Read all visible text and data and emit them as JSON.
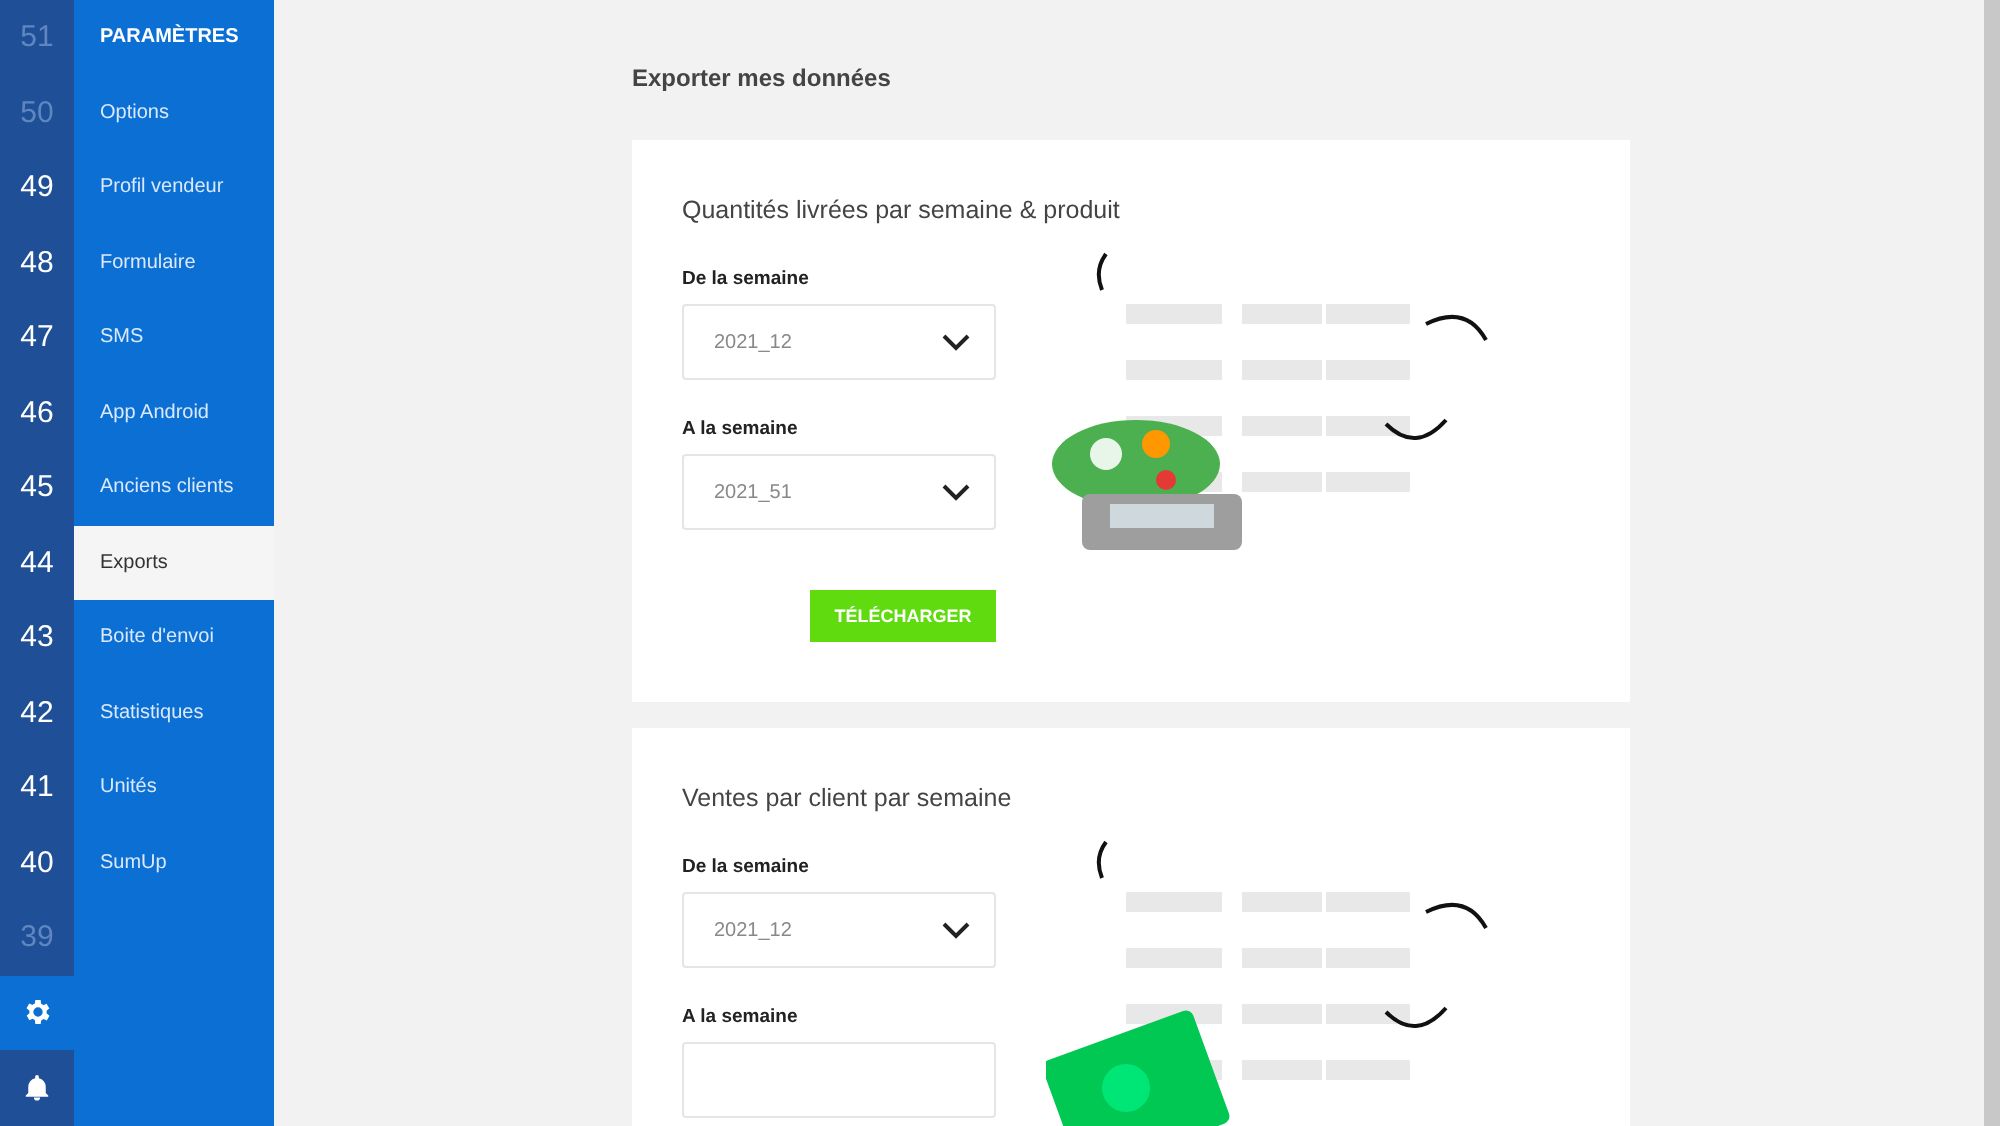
{
  "line_numbers": [
    {
      "label": "51",
      "dimmed": true
    },
    {
      "label": "50",
      "dimmed": true
    },
    {
      "label": "49",
      "dimmed": false
    },
    {
      "label": "48",
      "dimmed": false
    },
    {
      "label": "47",
      "dimmed": false
    },
    {
      "label": "46",
      "dimmed": false
    },
    {
      "label": "45",
      "dimmed": false
    },
    {
      "label": "44",
      "dimmed": false
    },
    {
      "label": "43",
      "dimmed": false
    },
    {
      "label": "42",
      "dimmed": false
    },
    {
      "label": "41",
      "dimmed": false
    },
    {
      "label": "40",
      "dimmed": false
    },
    {
      "label": "39",
      "dimmed": true
    }
  ],
  "sidebar": {
    "header": "PARAMÈTRES",
    "items": [
      {
        "label": "Options",
        "selected": false
      },
      {
        "label": "Profil vendeur",
        "selected": false
      },
      {
        "label": "Formulaire",
        "selected": false
      },
      {
        "label": "SMS",
        "selected": false
      },
      {
        "label": "App Android",
        "selected": false
      },
      {
        "label": "Anciens clients",
        "selected": false
      },
      {
        "label": "Exports",
        "selected": true
      },
      {
        "label": "Boite d'envoi",
        "selected": false
      },
      {
        "label": "Statistiques",
        "selected": false
      },
      {
        "label": "Unités",
        "selected": false
      },
      {
        "label": "SumUp",
        "selected": false
      }
    ]
  },
  "page_title": "Exporter mes données",
  "cards": [
    {
      "title": "Quantités livrées par semaine & produit",
      "kind": "produce",
      "from_label": "De la semaine",
      "from_value": "2021_12",
      "to_label": "A la semaine",
      "to_value": "2021_51",
      "button": "TÉLÉCHARGER"
    },
    {
      "title": "Ventes par client par semaine",
      "kind": "money",
      "from_label": "De la semaine",
      "from_value": "2021_12",
      "to_label": "A la semaine"
    }
  ]
}
